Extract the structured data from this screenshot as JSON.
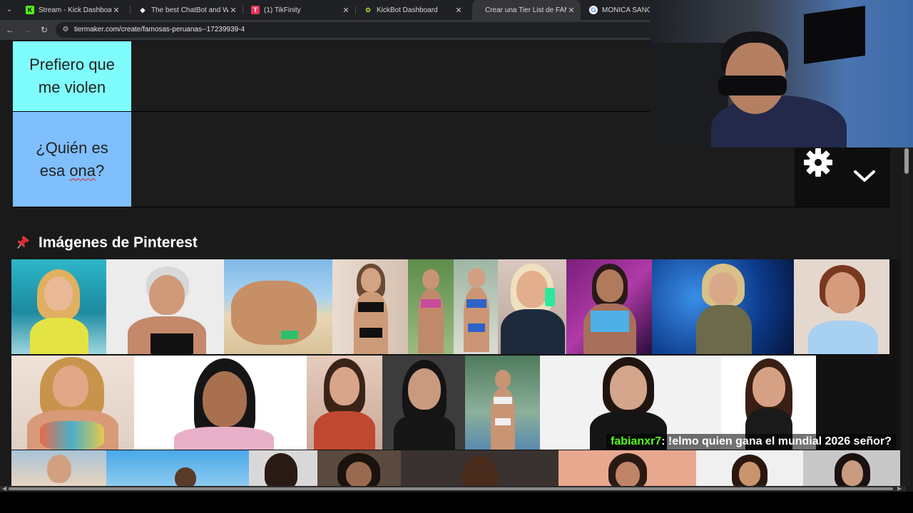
{
  "browser": {
    "tabs": [
      {
        "title": "Stream - Kick Dashboard",
        "favicon_color": "#53fc18",
        "favicon_glyph": "K"
      },
      {
        "title": "The best ChatBot and Widgets",
        "favicon_color": "#ffffff",
        "favicon_glyph": "◆"
      },
      {
        "title": "(1) TikFinity",
        "favicon_color": "#e8345a",
        "favicon_glyph": "T"
      },
      {
        "title": "KickBot Dashboard",
        "favicon_color": "#9acd32",
        "favicon_glyph": "✿"
      },
      {
        "title": "Crear una Tier List de FAMOSAS",
        "favicon_color": "#35363a",
        "favicon_glyph": ""
      },
      {
        "title": "MONICA SANCHEZ -",
        "favicon_color": "#ffffff",
        "favicon_glyph": "G"
      }
    ],
    "active_tab_index": 4,
    "url": "tiermaker.com/create/famosas-peruanas--17239939-4"
  },
  "tiers": [
    {
      "label": "Prefiero que me violen",
      "color": "#7ffdfd"
    },
    {
      "label_prefix": "¿Quién es esa ",
      "label_misspelled": "ona",
      "label_suffix": "?",
      "color": "#7fbffe"
    }
  ],
  "pinterest": {
    "title": "Imágenes de Pinterest",
    "icon": "pushpin-icon"
  },
  "chat": {
    "username": "fabianxr7",
    "message": ": !elmo quien gana el mundial 2026 señor?"
  },
  "icons": {
    "settings": "gear-icon",
    "expand": "chevron-down-icon"
  }
}
